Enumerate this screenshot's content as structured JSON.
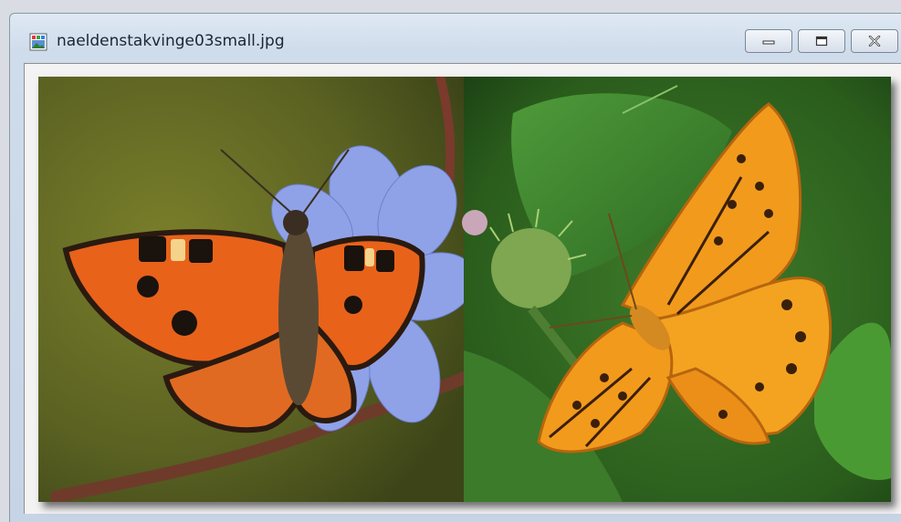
{
  "window": {
    "title": "naeldenstakvinge03small.jpg",
    "app_icon": "image-viewer-icon",
    "controls": {
      "minimize": "minimize-icon",
      "maximize": "maximize-icon",
      "close": "close-icon"
    }
  },
  "image": {
    "description_icon": "image",
    "panels": [
      "small-tortoiseshell-butterfly",
      "silver-washed-fritillary-butterfly"
    ]
  },
  "colors": {
    "left_background": "#5f6b22",
    "right_background": "#2f6a1e",
    "flower_blue": "#8fa2e8",
    "tortoiseshell_orange": "#e8621a",
    "fritillary_orange": "#f29a1c"
  }
}
